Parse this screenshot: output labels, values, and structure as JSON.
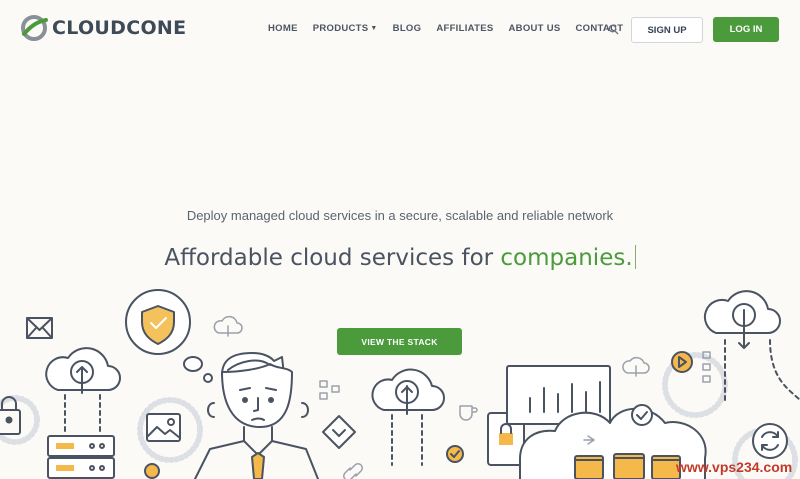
{
  "brand": {
    "name": "CLOUDCONE",
    "accent": "#4b9a3c",
    "text": "#3f4a58"
  },
  "nav": {
    "items": [
      {
        "label": "HOME"
      },
      {
        "label": "PRODUCTS",
        "has_dropdown": true
      },
      {
        "label": "BLOG"
      },
      {
        "label": "AFFILIATES"
      },
      {
        "label": "ABOUT US"
      },
      {
        "label": "CONTACT"
      }
    ],
    "search_icon": "search-icon",
    "signup_label": "SIGN UP",
    "login_label": "LOG IN"
  },
  "hero": {
    "tagline": "Deploy managed cloud services in a secure, scalable and reliable network",
    "headline_prefix": "Affordable cloud services for ",
    "headline_accent": "companies.",
    "cta_label": "VIEW THE STACK"
  },
  "watermark": "www.vps234.com",
  "illustration_icons": [
    "envelope-icon",
    "padlock-icon",
    "cloud-upload-icon",
    "server-rack-icon",
    "shield-check-icon",
    "image-icon",
    "person-figure",
    "diamond-arrows-icon",
    "link-icon",
    "cloud-icon",
    "coffee-cup-icon",
    "mobile-lock-icon",
    "bar-chart-icon",
    "folder-icon",
    "play-icon",
    "refresh-icon",
    "check-icon"
  ]
}
